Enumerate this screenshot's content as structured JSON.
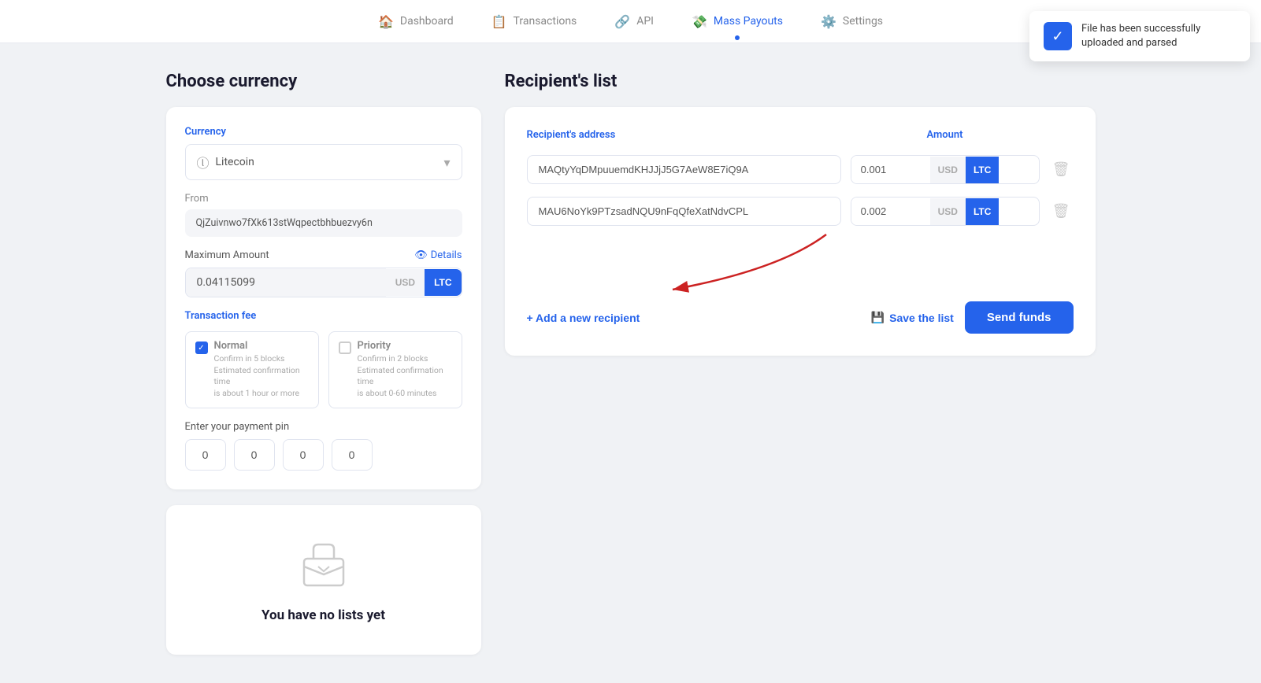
{
  "nav": {
    "items": [
      {
        "id": "dashboard",
        "label": "Dashboard",
        "active": false
      },
      {
        "id": "transactions",
        "label": "Transactions",
        "active": false
      },
      {
        "id": "api",
        "label": "API",
        "active": false
      },
      {
        "id": "mass-payouts",
        "label": "Mass Payouts",
        "active": true
      },
      {
        "id": "settings",
        "label": "Settings",
        "active": false
      }
    ]
  },
  "toast": {
    "message": "File has been successfully uploaded and parsed"
  },
  "left": {
    "title": "Choose currency",
    "currency_label": "Currency",
    "currency_value": "Litecoin",
    "from_label": "From",
    "from_value": "QjZuivnwo7fXk613stWqpectbhbuezvy6n",
    "max_amount_label": "Maximum Amount",
    "details_label": "Details",
    "max_amount_value": "0.04115099",
    "usd_label": "USD",
    "ltc_label": "LTC",
    "tx_fee_label": "Transaction fee",
    "fee_normal_name": "Normal",
    "fee_normal_detail": "Confirm in 5 blocks\nEstimated confirmation time\nis about 1 hour or more",
    "fee_priority_name": "Priority",
    "fee_priority_detail": "Confirm in 2 blocks\nEstimated confirmation time\nis about 0-60 minutes",
    "pin_label": "Enter your payment pin",
    "pin_values": [
      "0",
      "0",
      "0",
      "0"
    ]
  },
  "no_lists": {
    "text": "You have no lists yet"
  },
  "recipients": {
    "title": "Recipient's list",
    "col_address": "Recipient's address",
    "col_amount": "Amount",
    "rows": [
      {
        "address": "MAQtyYqDMpuuemdKHJJjJ5G7AeW8E7iQ9A",
        "amount": "0.001",
        "usd": "USD",
        "ltc": "LTC"
      },
      {
        "address": "MAU6NoYk9PTzsadNQU9nFqQfeXatNdvCPL",
        "amount": "0.002",
        "usd": "USD",
        "ltc": "LTC"
      }
    ],
    "add_label": "+ Add a new recipient",
    "save_label": "Save the list",
    "send_label": "Send funds"
  }
}
